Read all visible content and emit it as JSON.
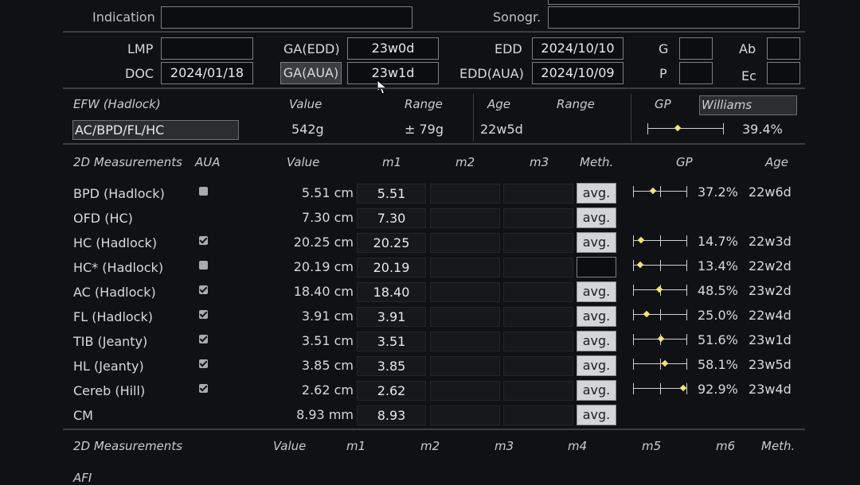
{
  "patient": {
    "indication_label": "Indication",
    "indication_value": "",
    "sonogr_label": "Sonogr.",
    "sonogr_value": ""
  },
  "dates": {
    "lmp_label": "LMP",
    "lmp_value": "",
    "doc_label": "DOC",
    "doc_value": "2024/01/18",
    "ga_edd_label": "GA(EDD)",
    "ga_edd_value": "23w0d",
    "ga_aua_label": "GA(AUA)",
    "ga_aua_value": "23w1d",
    "edd_label": "EDD",
    "edd_value": "2024/10/10",
    "edd_aua_label": "EDD(AUA)",
    "edd_aua_value": "2024/10/09",
    "g_label": "G",
    "g_value": "",
    "p_label": "P",
    "p_value": "",
    "ab_label": "Ab",
    "ab_value": "",
    "ec_label": "Ec",
    "ec_value": ""
  },
  "efw": {
    "header_method": "EFW (Hadlock)",
    "header_value": "Value",
    "header_range": "Range",
    "header_age": "Age",
    "header_age_range": "Range",
    "header_gp": "GP",
    "gp_author": "Williams",
    "formula": "AC/BPD/FL/HC",
    "value": "542g",
    "range": "± 79g",
    "age": "22w5d",
    "gp_percent": "39.4%",
    "gp_fraction": 0.394
  },
  "measurements": {
    "headers": {
      "name": "2D Measurements",
      "aua": "AUA",
      "value": "Value",
      "m1": "m1",
      "m2": "m2",
      "m3": "m3",
      "meth": "Meth.",
      "gp": "GP",
      "age": "Age"
    },
    "rows": [
      {
        "name": "BPD (Hadlock)",
        "aua": "unchecked",
        "value": "5.51 cm",
        "m1": "5.51",
        "meth": "avg.",
        "gp": "37.2%",
        "gp_fraction": 0.372,
        "age": "22w6d"
      },
      {
        "name": "OFD (HC)",
        "aua": "none",
        "value": "7.30 cm",
        "m1": "7.30",
        "meth": "avg.",
        "gp": "",
        "age": ""
      },
      {
        "name": "HC (Hadlock)",
        "aua": "checked",
        "value": "20.25 cm",
        "m1": "20.25",
        "meth": "avg.",
        "gp": "14.7%",
        "gp_fraction": 0.147,
        "age": "22w3d"
      },
      {
        "name": "HC* (Hadlock)",
        "aua": "unchecked",
        "value": "20.19 cm",
        "m1": "20.19",
        "meth": "",
        "gp": "13.4%",
        "gp_fraction": 0.134,
        "age": "22w2d"
      },
      {
        "name": "AC (Hadlock)",
        "aua": "checked",
        "value": "18.40 cm",
        "m1": "18.40",
        "meth": "avg.",
        "gp": "48.5%",
        "gp_fraction": 0.485,
        "age": "23w2d"
      },
      {
        "name": "FL (Hadlock)",
        "aua": "checked",
        "value": "3.91 cm",
        "m1": "3.91",
        "meth": "avg.",
        "gp": "25.0%",
        "gp_fraction": 0.25,
        "age": "22w4d"
      },
      {
        "name": "TIB (Jeanty)",
        "aua": "checked",
        "value": "3.51 cm",
        "m1": "3.51",
        "meth": "avg.",
        "gp": "51.6%",
        "gp_fraction": 0.516,
        "age": "23w1d"
      },
      {
        "name": "HL (Jeanty)",
        "aua": "checked",
        "value": "3.85 cm",
        "m1": "3.85",
        "meth": "avg.",
        "gp": "58.1%",
        "gp_fraction": 0.581,
        "age": "23w5d"
      },
      {
        "name": "Cereb (Hill)",
        "aua": "checked",
        "value": "2.62 cm",
        "m1": "2.62",
        "meth": "avg.",
        "gp": "92.9%",
        "gp_fraction": 0.929,
        "age": "23w4d"
      },
      {
        "name": "CM",
        "aua": "none",
        "value": "8.93 mm",
        "m1": "8.93",
        "meth": "avg.",
        "gp": "",
        "age": ""
      }
    ]
  },
  "measurements2": {
    "headers": {
      "name": "2D Measurements",
      "value": "Value",
      "m1": "m1",
      "m2": "m2",
      "m3": "m3",
      "m4": "m4",
      "m5": "m5",
      "m6": "m6",
      "meth": "Meth."
    },
    "first_row": "AFI"
  }
}
